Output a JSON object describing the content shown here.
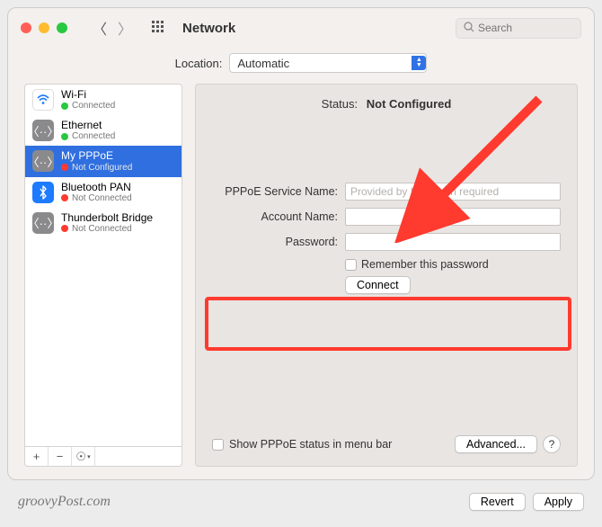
{
  "window": {
    "title": "Network"
  },
  "search": {
    "placeholder": "Search"
  },
  "location": {
    "label": "Location:",
    "selected": "Automatic"
  },
  "colors": {
    "green": "#28c840",
    "red": "#ff3a2f",
    "yellow": "#febc2e",
    "close": "#ff5f57"
  },
  "sidebar": {
    "items": [
      {
        "name": "Wi-Fi",
        "status": "Connected",
        "dot": "#28c840",
        "iconStyle": "light",
        "icon": "wifi"
      },
      {
        "name": "Ethernet",
        "status": "Connected",
        "dot": "#28c840",
        "iconStyle": "dark",
        "icon": "ethernet"
      },
      {
        "name": "My PPPoE",
        "status": "Not Configured",
        "dot": "#ff3a2f",
        "iconStyle": "dark",
        "icon": "ethernet",
        "selected": true
      },
      {
        "name": "Bluetooth PAN",
        "status": "Not Connected",
        "dot": "#ff3a2f",
        "iconStyle": "blue",
        "icon": "bluetooth"
      },
      {
        "name": "Thunderbolt Bridge",
        "status": "Not Connected",
        "dot": "#ff3a2f",
        "iconStyle": "dark",
        "icon": "ethernet"
      }
    ]
  },
  "main": {
    "status_label": "Status:",
    "status_value": "Not Configured",
    "pppoe_label": "PPPoE Service Name:",
    "pppoe_placeholder": "Provided by ISP when required",
    "account_label": "Account Name:",
    "password_label": "Password:",
    "remember_label": "Remember this password",
    "connect_label": "Connect",
    "show_status_label": "Show PPPoE status in menu bar",
    "advanced_label": "Advanced...",
    "help_label": "?"
  },
  "footer": {
    "brand": "groovyPost.com",
    "revert": "Revert",
    "apply": "Apply"
  }
}
